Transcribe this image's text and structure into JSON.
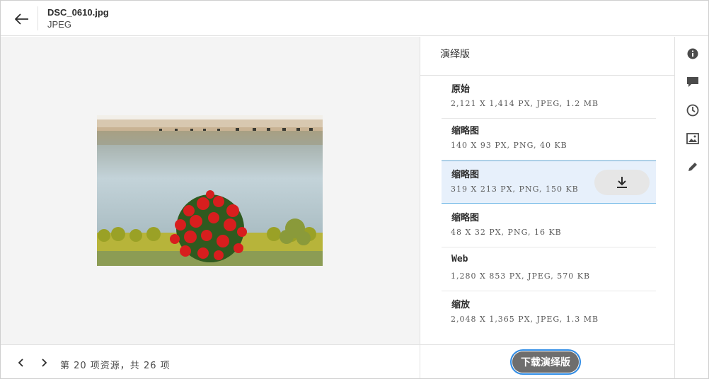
{
  "header": {
    "file_name": "DSC_0610.jpg",
    "file_type": "JPEG",
    "back_icon": "arrow-left-icon"
  },
  "footer": {
    "counter_text": "第 20 项资源，共 26 项",
    "prev_icon": "chevron-left-icon",
    "next_icon": "chevron-right-icon"
  },
  "panel": {
    "title": "演绎版",
    "renditions": [
      {
        "name": "原始",
        "meta": "2,121 X 1,414 PX, JPEG, 1.2 MB"
      },
      {
        "name": "缩略图",
        "meta": "140 X 93 PX, PNG, 40 KB"
      },
      {
        "name": "缩略图",
        "meta": "319 X 213 PX, PNG, 150 KB",
        "selected": true
      },
      {
        "name": "缩略图",
        "meta": "48 X 32 PX, PNG, 16 KB"
      },
      {
        "name": "Web",
        "meta": "1,280 X 853 PX, JPEG, 570 KB"
      },
      {
        "name": "缩放",
        "meta": "2,048 X 1,365 PX, JPEG, 1.3 MB"
      }
    ],
    "download_button": "下载演绎版"
  },
  "rail": {
    "icons": [
      "info-icon",
      "comment-icon",
      "history-icon",
      "renditions-icon",
      "edit-icon"
    ]
  },
  "colors": {
    "selected_row_bg": "#e7f0fb",
    "selected_row_border": "#6fb6e6",
    "focus_ring": "#2f8ce6",
    "primary_button_bg": "#6e6e6e"
  }
}
